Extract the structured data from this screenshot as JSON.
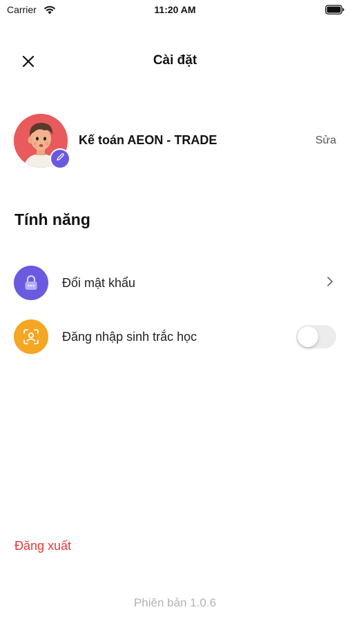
{
  "status_bar": {
    "carrier": "Carrier",
    "time": "11:20 AM"
  },
  "header": {
    "title": "Cài đặt",
    "close_icon": "close-icon"
  },
  "profile": {
    "name": "Kế toán AEON - TRADE",
    "edit_label": "Sửa",
    "avatar_bg": "#e85a5c",
    "edit_badge_color": "#6a5ae0"
  },
  "features": {
    "title": "Tính năng",
    "items": [
      {
        "label": "Đổi mật khẩu",
        "icon": "lock-icon",
        "icon_bg": "#6a5ae0",
        "action": "chevron-right-icon"
      },
      {
        "label": "Đăng nhập sinh trắc học",
        "icon": "face-id-icon",
        "icon_bg": "#f5a623",
        "action": "toggle",
        "toggle_on": false
      }
    ]
  },
  "logout": {
    "label": "Đăng xuất",
    "color": "#e53935"
  },
  "version": {
    "label": "Phiên bản 1.0.6"
  }
}
